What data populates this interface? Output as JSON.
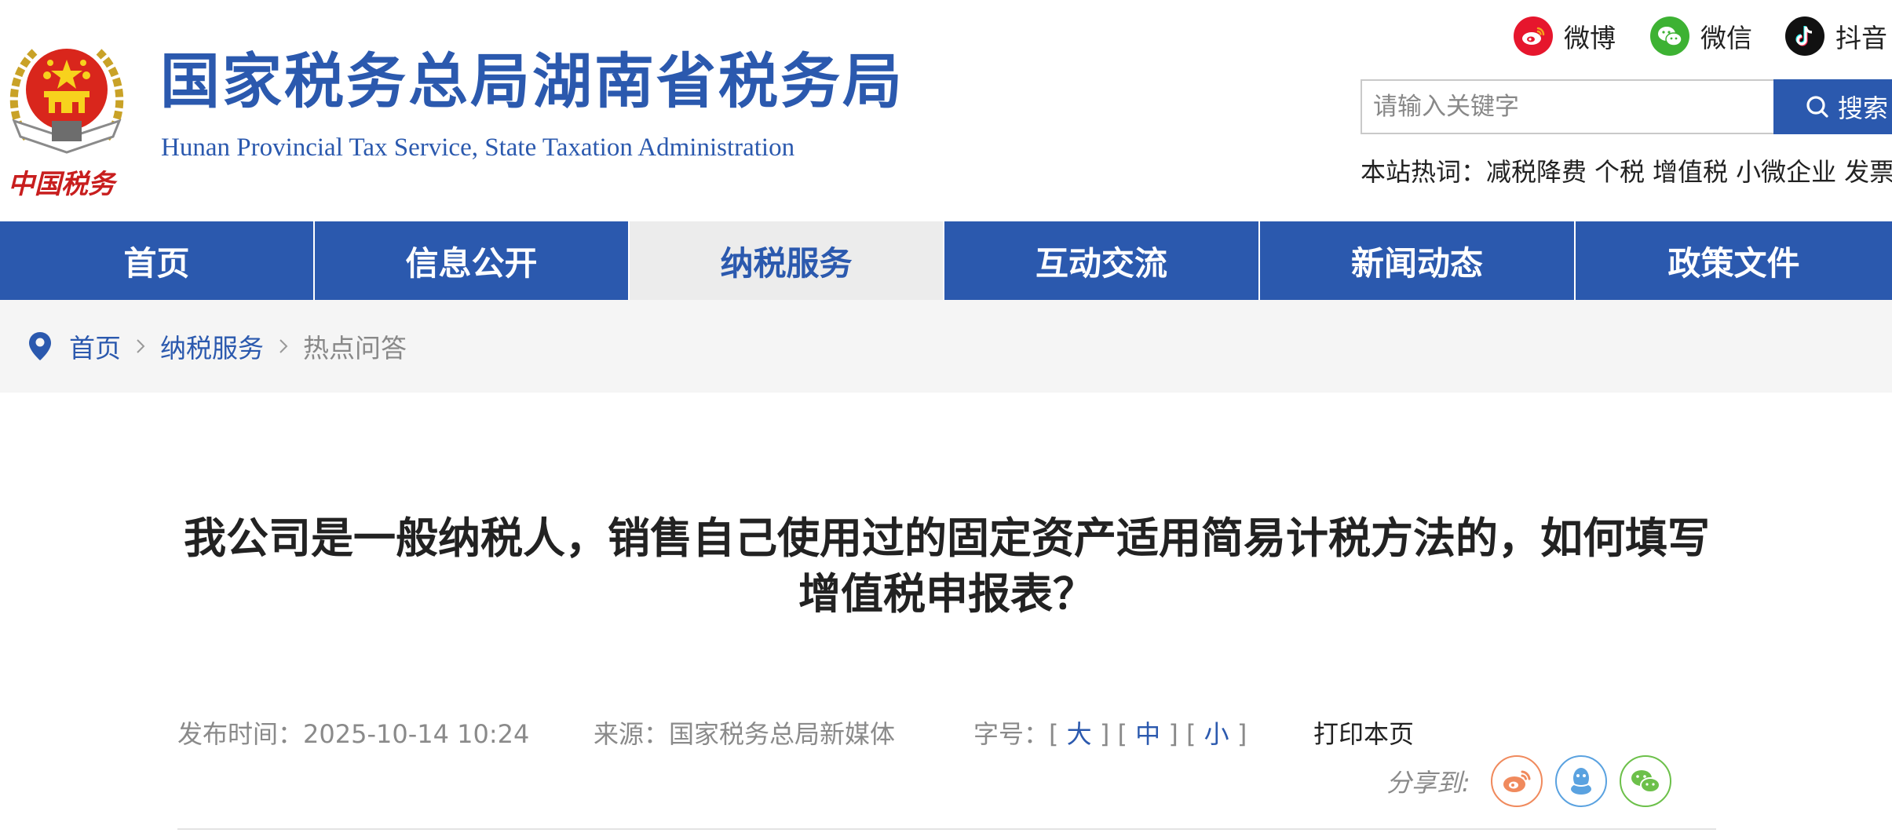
{
  "header": {
    "site_title": "国家税务总局湖南省税务局",
    "site_subtitle": "Hunan Provincial  Tax Service,  State Taxation Administration",
    "logo_text": "中国税务",
    "social": [
      {
        "label": "微博",
        "icon": "weibo-icon",
        "color": "#e6162d"
      },
      {
        "label": "微信",
        "icon": "wechat-icon",
        "color": "#3db233"
      },
      {
        "label": "抖音",
        "icon": "douyin-icon",
        "color": "#111111"
      }
    ],
    "search": {
      "placeholder": "请输入关键字",
      "button_label": "搜索"
    },
    "hotwords": {
      "prefix": "本站热词：",
      "items": [
        "减税降费",
        "个税",
        "增值税",
        "小微企业",
        "发票"
      ]
    }
  },
  "nav": {
    "items": [
      {
        "label": "首页",
        "active": false
      },
      {
        "label": "信息公开",
        "active": false
      },
      {
        "label": "纳税服务",
        "active": true
      },
      {
        "label": "互动交流",
        "active": false
      },
      {
        "label": "新闻动态",
        "active": false
      },
      {
        "label": "政策文件",
        "active": false
      }
    ]
  },
  "breadcrumb": {
    "items": [
      "首页",
      "纳税服务",
      "热点问答"
    ]
  },
  "article": {
    "title": "我公司是一般纳税人，销售自己使用过的固定资产适用简易计税方法的，如何填写增值税申报表？",
    "publish_label": "发布时间：",
    "publish_time": "2025-10-14 10:24",
    "source_label": "来源：",
    "source": "国家税务总局新媒体",
    "font_label": "字号：",
    "font_sizes": [
      "大",
      "中",
      "小"
    ],
    "print_label": "打印本页",
    "share_label": "分享到:",
    "share_targets": [
      "weibo-share-icon",
      "qq-share-icon",
      "wechat-share-icon"
    ]
  },
  "colors": {
    "brand_blue": "#2b59ae",
    "nav_active_bg": "#ececec",
    "breadcrumb_bg": "#f5f5f5"
  }
}
